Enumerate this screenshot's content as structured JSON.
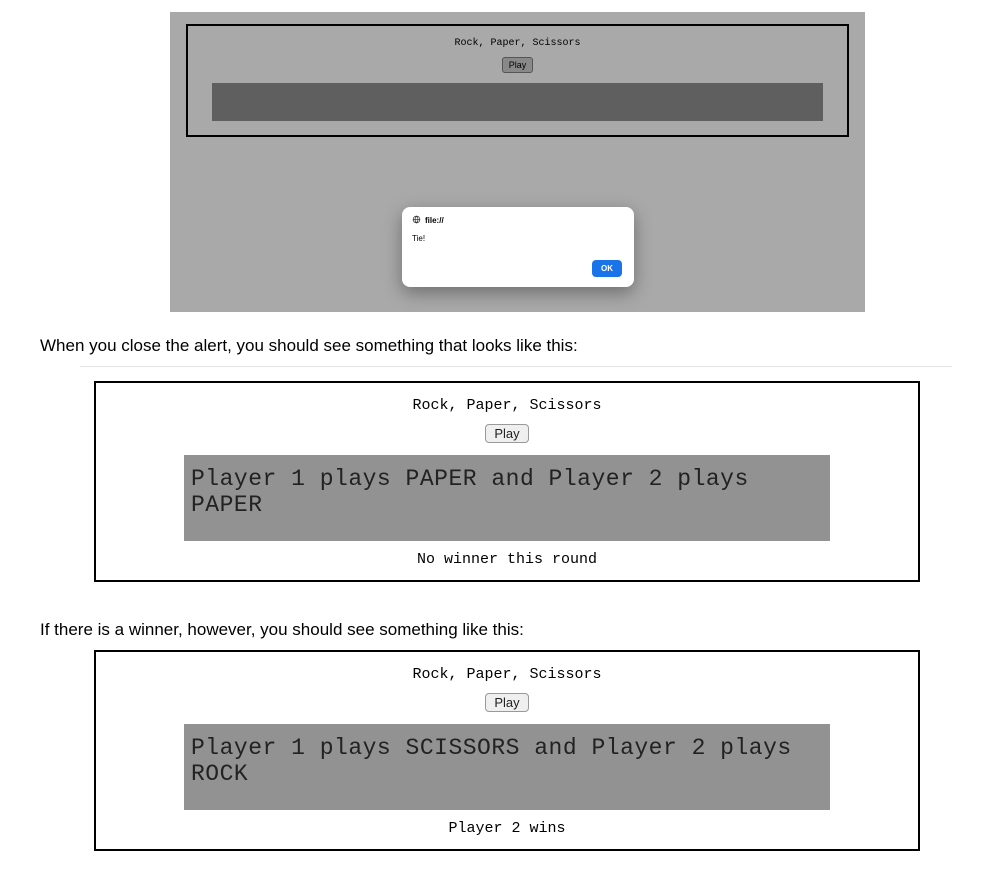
{
  "figure1": {
    "title": "Rock, Paper, Scissors",
    "play_label": "Play",
    "alert": {
      "origin_label": "file://",
      "message": "Tie!",
      "ok_label": "OK"
    }
  },
  "instruction1": "When you close the alert, you should see something that looks like this:",
  "figure2": {
    "title": "Rock, Paper, Scissors",
    "play_label": "Play",
    "round_text": "Player 1 plays PAPER and Player 2 plays PAPER",
    "result_text": "No winner this round"
  },
  "instruction2": "If there is a winner, however, you should see something like this:",
  "figure3": {
    "title": "Rock, Paper, Scissors",
    "play_label": "Play",
    "round_text": "Player 1 plays SCISSORS and Player 2 plays ROCK",
    "result_text": "Player 2 wins"
  }
}
